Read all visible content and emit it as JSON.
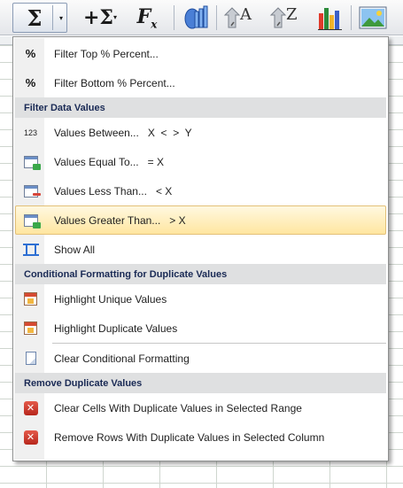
{
  "toolbar": {
    "autosum_glyph": "Σ",
    "autosum2_glyph": "+Σ",
    "dropdown_glyph": "▾",
    "fx_glyph": "F",
    "fx_sub": "x",
    "sort_az_glyph": "A",
    "sort_za_glyph": "Z",
    "icons": [
      "autosum-icon",
      "insert-sum-icon",
      "insert-function-icon",
      "chart-wizard-icon",
      "sort-ascending-icon",
      "sort-descending-icon",
      "column-chart-icon",
      "picture-icon"
    ]
  },
  "menu": {
    "filter_top_label": "Filter Top % Percent...",
    "filter_top_key": "F",
    "filter_bottom_label": "Filter Bottom % Percent...",
    "filter_bottom_key": "i",
    "pct_glyph": "%",
    "section_filter_data": "Filter Data Values",
    "values_between_icon": "123",
    "values_between_label": "Values Between...",
    "values_between_suffix": "X  <  >  Y",
    "values_equal_label": "Values Equal To...",
    "values_equal_suffix": "= X",
    "values_less_label": "Values Less Than...",
    "values_less_suffix": "< X",
    "values_greater_label": "Values Greater Than...",
    "values_greater_suffix": "> X",
    "show_all_label": "Show All",
    "section_conditional": "Conditional Formatting for Duplicate Values",
    "highlight_unique_label": "Highlight Unique Values",
    "highlight_duplicate_label": "Highlight Duplicate Values",
    "clear_cf_label": "Clear Conditional Formatting",
    "section_remove_dup": "Remove Duplicate Values",
    "clear_cells_label": "Clear Cells With Duplicate Values in Selected Range",
    "remove_rows_label": "Remove Rows With Duplicate Values in Selected Column",
    "x_glyph": "✕"
  },
  "colors": {
    "highlight_bg": "#ffe6a0",
    "section_header_bg": "#dfe0e1",
    "section_header_text": "#1a2a55",
    "accent_blue": "#2e6fd3",
    "danger_red": "#c8342a"
  }
}
